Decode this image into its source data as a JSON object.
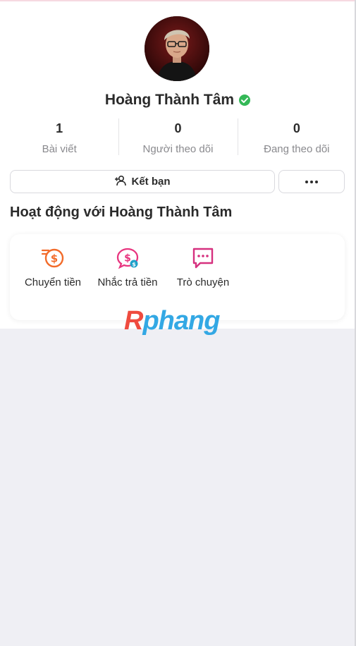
{
  "profile": {
    "name": "Hoàng Thành Tâm",
    "verified": true
  },
  "stats": [
    {
      "value": "1",
      "label": "Bài viết"
    },
    {
      "value": "0",
      "label": "Người theo dõi"
    },
    {
      "value": "0",
      "label": "Đang theo dõi"
    }
  ],
  "buttons": {
    "add_friend": "Kết bạn",
    "more_icon": "more-icon"
  },
  "activity": {
    "title": "Hoạt động với Hoàng Thành Tâm",
    "items": [
      {
        "label": "Chuyển tiền",
        "icon": "money-transfer-icon",
        "color": "#f26b2a"
      },
      {
        "label": "Nhắc trả tiền",
        "icon": "payment-reminder-icon",
        "color": "#e8357f"
      },
      {
        "label": "Trò chuyện",
        "icon": "chat-icon",
        "color": "#d6317f"
      }
    ]
  },
  "watermark": {
    "first": "R",
    "rest": "phang"
  },
  "colors": {
    "verified": "#34b857",
    "accent_orange": "#f26b2a",
    "accent_pink": "#e8357f"
  }
}
